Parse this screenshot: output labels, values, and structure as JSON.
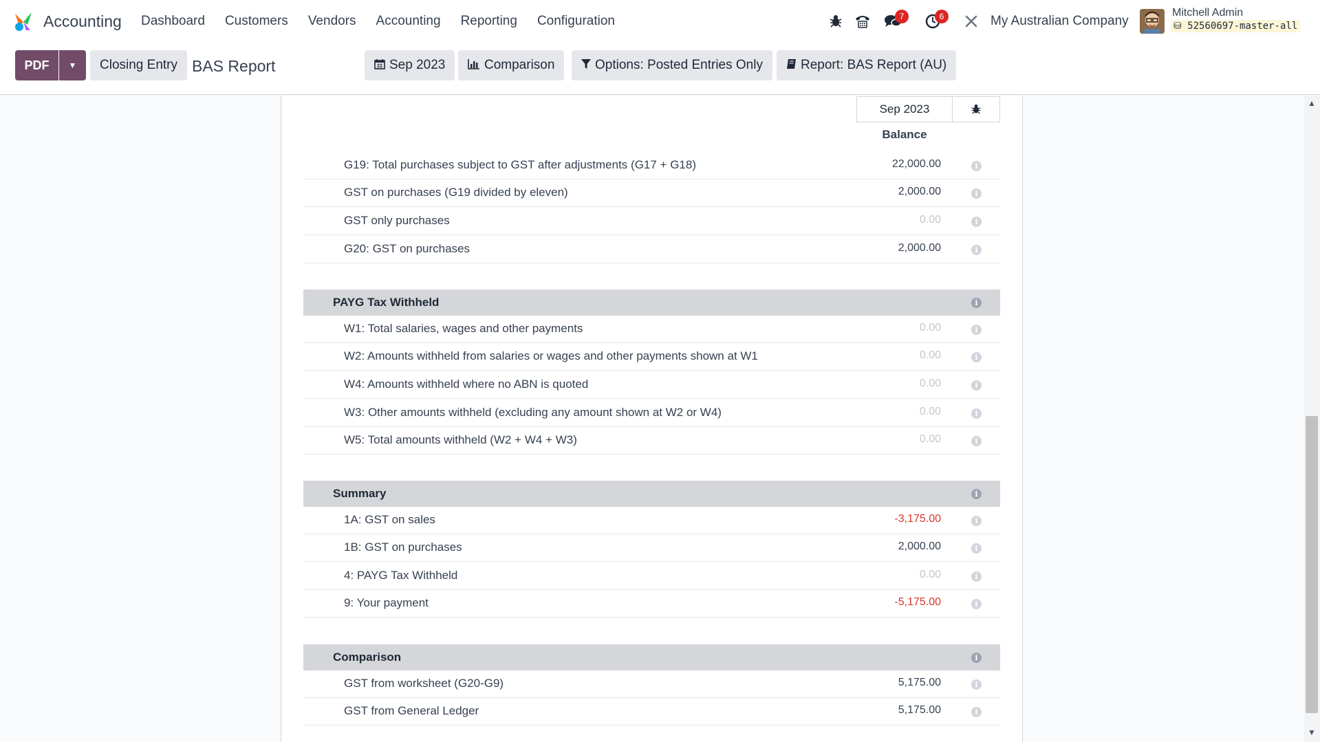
{
  "app": {
    "name": "Accounting"
  },
  "menu": [
    "Dashboard",
    "Customers",
    "Vendors",
    "Accounting",
    "Reporting",
    "Configuration"
  ],
  "systray": {
    "messages_badge": "7",
    "activities_badge": "6",
    "company": "My Australian Company",
    "user": "Mitchell Admin",
    "database": "52560697-master-all"
  },
  "control": {
    "pdf_label": "PDF",
    "closing_label": "Closing Entry",
    "title": "BAS Report",
    "filters": {
      "period": "Sep 2023",
      "comparison": "Comparison",
      "options": "Options: Posted Entries Only",
      "report": "Report: BAS Report (AU)"
    }
  },
  "table": {
    "column": "Sep 2023",
    "subheader": "Balance",
    "rows": [
      {
        "label": "G19: Total purchases subject to GST after adjustments (G17 + G18)",
        "value": "22,000.00"
      },
      {
        "label": "GST on purchases (G19 divided by eleven)",
        "value": "2,000.00"
      },
      {
        "label": "GST only purchases",
        "value": "0.00"
      },
      {
        "label": "G20: GST on purchases",
        "value": "2,000.00"
      }
    ],
    "payg": {
      "title": "PAYG Tax Withheld",
      "rows": [
        {
          "label": "W1: Total salaries, wages and other payments",
          "value": "0.00"
        },
        {
          "label": "W2: Amounts withheld from salaries or wages and other payments shown at W1",
          "value": "0.00"
        },
        {
          "label": "W4: Amounts withheld where no ABN is quoted",
          "value": "0.00"
        },
        {
          "label": "W3: Other amounts withheld (excluding any amount shown at W2 or W4)",
          "value": "0.00"
        },
        {
          "label": "W5: Total amounts withheld (W2 + W4 + W3)",
          "value": "0.00"
        }
      ]
    },
    "summary": {
      "title": "Summary",
      "rows": [
        {
          "label": "1A: GST on sales",
          "value": "-3,175.00"
        },
        {
          "label": "1B: GST on purchases",
          "value": "2,000.00"
        },
        {
          "label": "4: PAYG Tax Withheld",
          "value": "0.00"
        },
        {
          "label": "9: Your payment",
          "value": "-5,175.00"
        }
      ]
    },
    "comparison": {
      "title": "Comparison",
      "rows": [
        {
          "label": "GST from worksheet (G20-G9)",
          "value": "5,175.00"
        },
        {
          "label": "GST from General Ledger",
          "value": "5,175.00"
        }
      ]
    }
  },
  "colors": {
    "primary": "#714b67",
    "negative": "#d9362b",
    "section_bg": "#d4d6da"
  }
}
